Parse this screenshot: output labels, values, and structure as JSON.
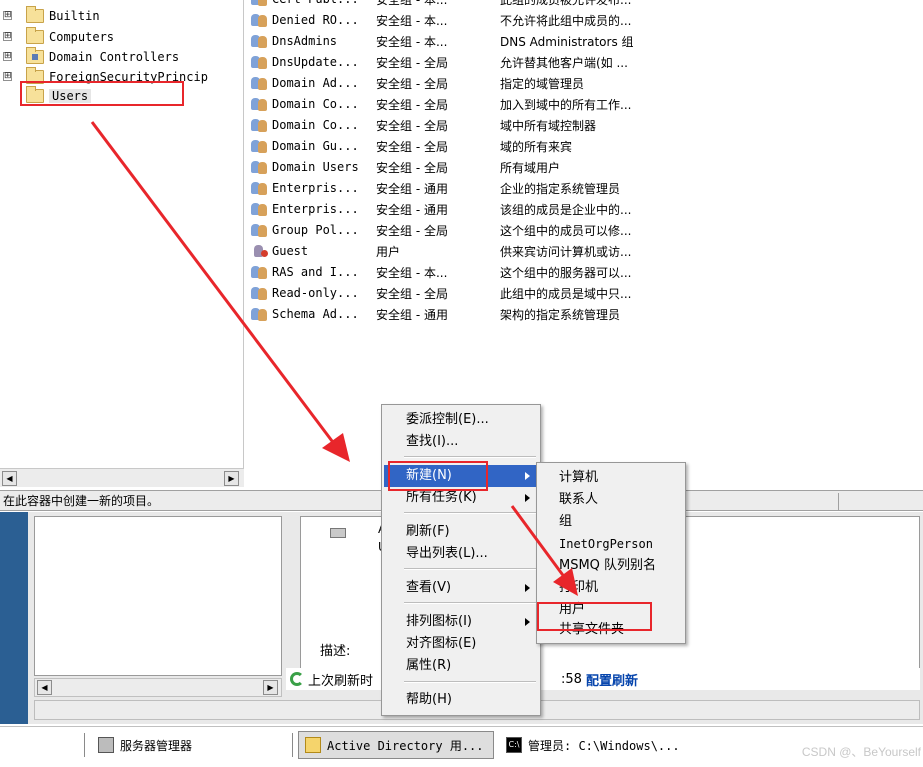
{
  "tree": {
    "items": [
      {
        "label": "Builtin",
        "expander": "⊞",
        "kind": "folder"
      },
      {
        "label": "Computers",
        "expander": "⊞",
        "kind": "folder"
      },
      {
        "label": "Domain Controllers",
        "expander": "⊞",
        "kind": "dc"
      },
      {
        "label": "ForeignSecurityPrincip",
        "expander": "⊞",
        "kind": "folder"
      },
      {
        "label": "Users",
        "expander": "",
        "kind": "folder",
        "selected": true
      }
    ]
  },
  "list": {
    "rows": [
      {
        "name": "Cert Publ...",
        "type": "安全组 - 本...",
        "desc": "此组的成员被允许发布...",
        "icon": "group"
      },
      {
        "name": "Denied RO...",
        "type": "安全组 - 本...",
        "desc": "不允许将此组中成员的...",
        "icon": "group"
      },
      {
        "name": "DnsAdmins",
        "type": "安全组 - 本...",
        "desc": "DNS Administrators 组",
        "icon": "group"
      },
      {
        "name": "DnsUpdate...",
        "type": "安全组 - 全局",
        "desc": "允许替其他客户端(如 ...",
        "icon": "group"
      },
      {
        "name": "Domain Ad...",
        "type": "安全组 - 全局",
        "desc": "指定的域管理员",
        "icon": "group"
      },
      {
        "name": "Domain Co...",
        "type": "安全组 - 全局",
        "desc": "加入到域中的所有工作...",
        "icon": "group"
      },
      {
        "name": "Domain Co...",
        "type": "安全组 - 全局",
        "desc": "域中所有域控制器",
        "icon": "group"
      },
      {
        "name": "Domain Gu...",
        "type": "安全组 - 全局",
        "desc": "域的所有来宾",
        "icon": "group"
      },
      {
        "name": "Domain Users",
        "type": "安全组 - 全局",
        "desc": "所有域用户",
        "icon": "group"
      },
      {
        "name": "Enterpris...",
        "type": "安全组 - 通用",
        "desc": "企业的指定系统管理员",
        "icon": "group"
      },
      {
        "name": "Enterpris...",
        "type": "安全组 - 通用",
        "desc": "该组的成员是企业中的...",
        "icon": "group"
      },
      {
        "name": "Group Pol...",
        "type": "安全组 - 全局",
        "desc": "这个组中的成员可以修...",
        "icon": "group"
      },
      {
        "name": "Guest",
        "type": "用户",
        "desc": "供来宾访问计算机或访...",
        "icon": "user-disabled"
      },
      {
        "name": "RAS and I...",
        "type": "安全组 - 本...",
        "desc": "这个组中的服务器可以...",
        "icon": "group"
      },
      {
        "name": "Read-only...",
        "type": "安全组 - 全局",
        "desc": "此组中的成员是域中只...",
        "icon": "group"
      },
      {
        "name": "Schema Ad...",
        "type": "安全组 - 通用",
        "desc": "架构的指定系统管理员",
        "icon": "group"
      }
    ]
  },
  "status": {
    "text": "在此容器中创建一新的项目。"
  },
  "context_menu": {
    "items": [
      {
        "label": "委派控制(E)...",
        "submenu": false
      },
      {
        "label": "查找(I)...",
        "submenu": false
      },
      {
        "label": "新建(N)",
        "submenu": true,
        "highlighted": true
      },
      {
        "label": "所有任务(K)",
        "submenu": true
      },
      {
        "label": "刷新(F)",
        "submenu": false
      },
      {
        "label": "导出列表(L)...",
        "submenu": false
      },
      {
        "label": "查看(V)",
        "submenu": true
      },
      {
        "label": "排列图标(I)",
        "submenu": true
      },
      {
        "label": "对齐图标(E)",
        "submenu": false
      },
      {
        "label": "属性(R)",
        "submenu": false
      },
      {
        "label": "帮助(H)",
        "submenu": false
      }
    ]
  },
  "submenu": {
    "items": [
      "计算机",
      "联系人",
      "组",
      "InetOrgPerson",
      "MSMQ 队列别名",
      "打印机",
      "用户",
      "共享文件夹"
    ]
  },
  "lower": {
    "desc_label": "描述:",
    "refresh_prefix": "上次刷新时",
    "refresh_suffix": ":58",
    "config_link": "配置刷新",
    "small_a": "A",
    "small_u": "U"
  },
  "taskbar": {
    "server_manager": "服务器管理器",
    "ad_window": "Active Directory 用...",
    "cmd_window": "管理员: C:\\Windows\\...",
    "cmd_icon": "C:\\",
    "watermark": "CSDN @、BeYourself"
  },
  "colors": {
    "annotation_red": "#e8262b",
    "menu_highlight": "#3165c5"
  }
}
